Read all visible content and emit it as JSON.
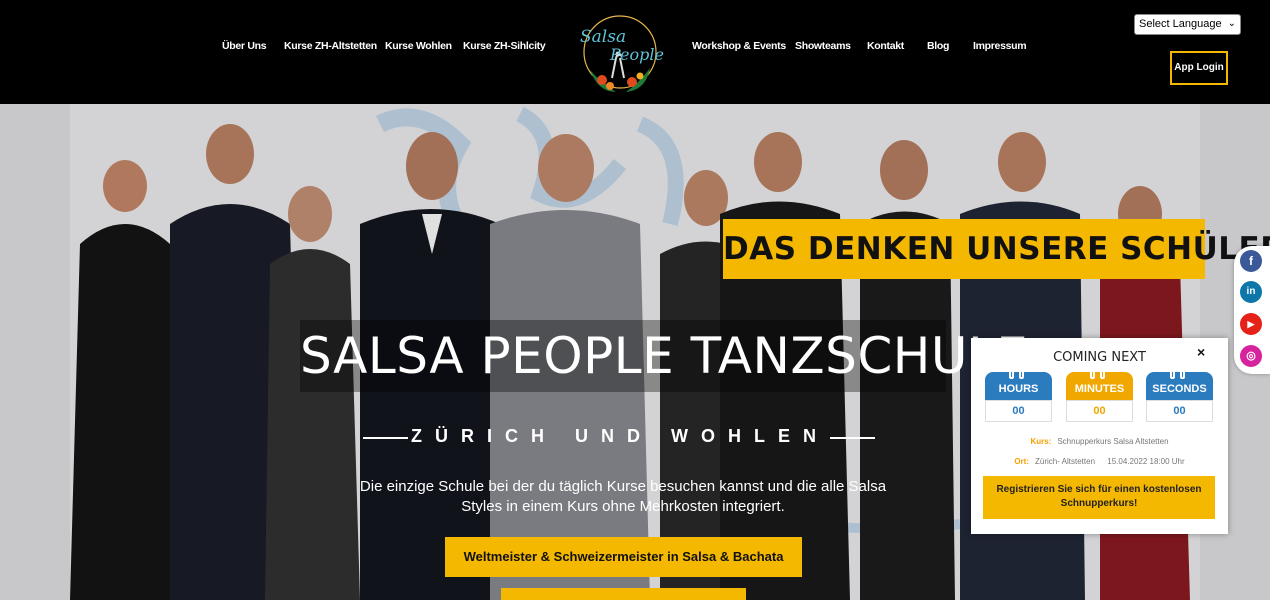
{
  "nav": {
    "left": [
      "Über Uns",
      "Kurse ZH-Altstetten",
      "Kurse Wohlen",
      "Kurse ZH-Sihlcity"
    ],
    "right": [
      "Workshop & Events",
      "Showteams",
      "Kontakt",
      "Blog",
      "Impressum"
    ],
    "logo_text": [
      "Salsa",
      "People"
    ]
  },
  "language": {
    "selected": "Select Language"
  },
  "app_login": "App Login",
  "hero": {
    "quote_banner": "DAS DENKEN UNSERE SCHÜLER",
    "title": "SALSA PEOPLE TANZSCHULE",
    "subtitle": "ZÜRICH UND WOHLEN",
    "description": "Die einzige Schule bei der du täglich Kurse besuchen kannst und die alle Salsa Styles in einem Kurs ohne Mehrkosten integriert.",
    "cta_primary": "Weltmeister & Schweizermeister in Salsa & Bachata"
  },
  "social": [
    "facebook-icon",
    "linkedin-icon",
    "youtube-icon",
    "instagram-icon"
  ],
  "widget": {
    "title": "COMING NEXT",
    "close": "×",
    "countdown": [
      {
        "label": "HOURS",
        "value": "00",
        "color": "#2b7bbf"
      },
      {
        "label": "MINUTES",
        "value": "00",
        "color": "#f0a800"
      },
      {
        "label": "SECONDS",
        "value": "00",
        "color": "#2b7bbf"
      }
    ],
    "course_label": "Kurs:",
    "course_value": "Schnupperkurs Salsa Altstetten",
    "place_label": "Ort:",
    "place_value": "Zürich- Altstetten",
    "datetime": "15.04.2022 18:00 Uhr",
    "button": "Registrieren Sie sich für einen kostenlosen Schnupperkurs!"
  },
  "colors": {
    "accent": "#f5b800",
    "header_bg": "#000000"
  }
}
